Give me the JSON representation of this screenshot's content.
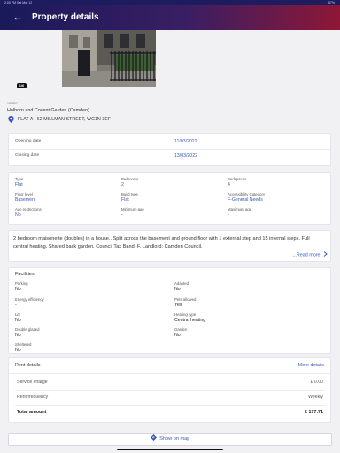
{
  "status_bar": {
    "time": "2:00 PM",
    "date": "Sat Mar 12",
    "battery": "87%"
  },
  "header": {
    "title": "Property details",
    "back_glyph": "←"
  },
  "photo": {
    "badge": "1/6"
  },
  "property": {
    "ref": "193607",
    "office": "Holborn and Covent Garden (Camden)",
    "address": "FLAT A , 62 MILLMAN STREET, WC1N 3EF"
  },
  "dates": {
    "opening_label": "Opening date",
    "opening_value": "11/03/2022",
    "closing_label": "Closing date",
    "closing_value": "13/03/2022"
  },
  "attributes": [
    {
      "label": "Type",
      "value": "Flat",
      "blue": true
    },
    {
      "label": "Bedrooms",
      "value": "2",
      "blue": true
    },
    {
      "label": "Bedspaces",
      "value": "4",
      "blue": true
    },
    {
      "label": "Floor level",
      "value": "Basement",
      "blue": true
    },
    {
      "label": "Build type",
      "value": "Flat",
      "blue": true
    },
    {
      "label": "Accessibility Category",
      "value": "F-General Needs",
      "blue": true
    },
    {
      "label": "Age restrictions",
      "value": "No",
      "blue": true
    },
    {
      "label": "Minimum age",
      "value": "-",
      "blue": false
    },
    {
      "label": "Maximum age",
      "value": "-",
      "blue": false
    }
  ],
  "description": {
    "text": "2 bedroom maisonette (doubles) in a house.. Split across the basement and ground floor with 1 external step and 15 internal steps. Full central heating. Shared back garden. Council Tax Band: F. Landlord: Camden Council.",
    "read_more": "...Read more"
  },
  "facilities": {
    "title": "Facilities",
    "items": [
      {
        "label": "Parking",
        "value": "No"
      },
      {
        "label": "Adapted",
        "value": "No"
      },
      {
        "label": "Energy efficiency",
        "value": "-"
      },
      {
        "label": "Pets allowed",
        "value": "Yes"
      },
      {
        "label": "Lift",
        "value": "No"
      },
      {
        "label": "Heating type",
        "value": "Central heating"
      },
      {
        "label": "Double glazed",
        "value": "No"
      },
      {
        "label": "Garden",
        "value": "No"
      },
      {
        "label": "Sheltered",
        "value": "No"
      }
    ]
  },
  "rent": {
    "title": "Rent details",
    "more": "More details",
    "service_label": "Service charge",
    "service_value": "£ 0.00",
    "frequency_label": "Rent frequency",
    "frequency_value": "Weekly",
    "total_label": "Total amount",
    "total_value": "£ 177.71"
  },
  "map_button": {
    "label": "Show on map"
  },
  "colors": {
    "accent": "#3a57b7",
    "header_start": "#191a5a",
    "header_end": "#8e1736"
  },
  "icons": [
    "back-arrow-icon",
    "location-pin-icon",
    "chevron-right-icon",
    "map-icon"
  ]
}
